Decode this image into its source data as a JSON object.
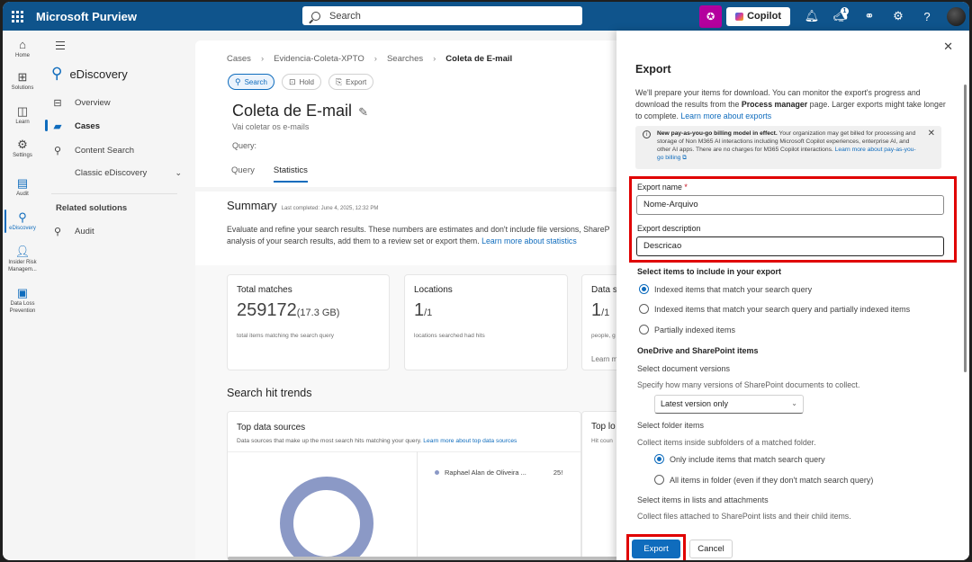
{
  "topbar": {
    "app_name": "Microsoft Purview",
    "search_placeholder": "Search",
    "copilot_label": "Copilot",
    "notification_badge": "1"
  },
  "rail": {
    "items": [
      {
        "label": "Home",
        "icon": "home-icon"
      },
      {
        "label": "Solutions",
        "icon": "grid-icon"
      },
      {
        "label": "Learn",
        "icon": "book-icon"
      },
      {
        "label": "Settings",
        "icon": "gear-icon"
      },
      {
        "label": "Audit",
        "icon": "audit-icon"
      },
      {
        "label": "eDiscovery",
        "icon": "ediscovery-icon"
      },
      {
        "label": "Insider Risk Managem...",
        "icon": "insider-risk-icon"
      },
      {
        "label": "Data Loss Prevention",
        "icon": "dlp-icon"
      }
    ]
  },
  "nav": {
    "title": "eDiscovery",
    "overview": "Overview",
    "cases": "Cases",
    "content_search": "Content Search",
    "classic": "Classic eDiscovery",
    "related_heading": "Related solutions",
    "audit": "Audit"
  },
  "main": {
    "breadcrumb": [
      "Cases",
      "Evidencia-Coleta-XPTO",
      "Searches",
      "Coleta de E-mail"
    ],
    "pills": [
      "Search",
      "Hold",
      "Export"
    ],
    "title": "Coleta de E-mail",
    "subtitle": "Vai coletar os e-mails",
    "query_label": "Query:",
    "tabs": [
      "Query",
      "Statistics"
    ],
    "summary_title": "Summary",
    "summary_date": "Last completed: June 4, 2025, 12:32 PM",
    "summary_desc_1": "Evaluate and refine your search results. These numbers are estimates and don't include file versions, ShareP",
    "summary_desc_2": "analysis of your search results, add them to a review set or export them.",
    "summary_link": "Learn more about statistics",
    "cards": [
      {
        "title": "Total matches",
        "value": "259172",
        "extra": "(17.3 GB)",
        "note": "total items matching the search query"
      },
      {
        "title": "Locations",
        "value": "1",
        "extra": "/1",
        "note": "locations searched had hits"
      },
      {
        "title": "Data s",
        "value": "1",
        "extra": "/1",
        "note": "people, g",
        "link": "Learn m"
      }
    ],
    "trends_title": "Search hit trends",
    "top_sources_title": "Top data sources",
    "top_sources_desc": "Data sources that make up the most search hits matching your query.",
    "top_sources_link": "Learn more about top data sources",
    "top_lo_title": "Top lo",
    "top_lo_desc": "Hit coun",
    "legend_name": "Raphael Alan de Oliveira ...",
    "legend_value": "25!"
  },
  "panel": {
    "title": "Export",
    "desc_1": "We'll prepare your items for download. You can monitor the export's progress and download the results from the",
    "desc_bold": "Process manager",
    "desc_2": "page. Larger exports might take longer to complete.",
    "desc_link": "Learn more about exports",
    "msg_bold": "New pay-as-you-go billing model in effect.",
    "msg_text": "Your organization may get billed for processing and storage of Non M365 AI interactions including Microsoft Copilot experiences, enterprise AI, and other AI apps. There are no charges for M365 Copilot interactions.",
    "msg_link": "Learn more about pay-as-you-go billing",
    "export_name_label": "Export name",
    "export_name_value": "Nome-Arquivo",
    "export_desc_label": "Export description",
    "export_desc_value": "Descricao",
    "select_items_heading": "Select items to include in your export",
    "radio_indexed": "Indexed items that match your search query",
    "radio_indexed_partial": "Indexed items that match your search query and partially indexed items",
    "radio_partial": "Partially indexed items",
    "od_heading": "OneDrive and SharePoint items",
    "doc_versions_label": "Select document versions",
    "doc_versions_desc": "Specify how many versions of SharePoint documents to collect.",
    "doc_versions_value": "Latest version only",
    "folder_label": "Select folder items",
    "folder_desc": "Collect items inside subfolders of a matched folder.",
    "folder_opt1": "Only include items that match search query",
    "folder_opt2": "All items in folder (even if they don't match search query)",
    "lists_label": "Select items in lists and attachments",
    "lists_desc": "Collect files attached to SharePoint lists and their child items.",
    "export_button": "Export",
    "cancel_button": "Cancel"
  },
  "colors": {
    "topbar": "#0f548c",
    "accent": "#0f6cbd",
    "highlight": "#e00000",
    "donut": "#8b99c6"
  }
}
